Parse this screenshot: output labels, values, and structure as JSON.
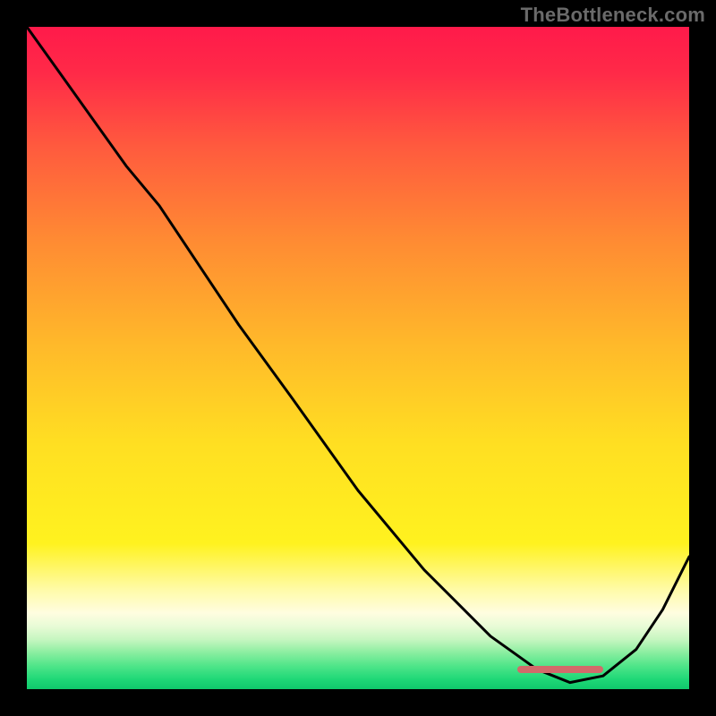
{
  "attribution": "TheBottleneck.com",
  "gradient_stops": [
    {
      "offset": 0.0,
      "color": "#ff1a4a"
    },
    {
      "offset": 0.07,
      "color": "#ff2a48"
    },
    {
      "offset": 0.18,
      "color": "#ff5a3e"
    },
    {
      "offset": 0.32,
      "color": "#ff8a33"
    },
    {
      "offset": 0.48,
      "color": "#ffb92a"
    },
    {
      "offset": 0.63,
      "color": "#ffdf22"
    },
    {
      "offset": 0.78,
      "color": "#fff21f"
    },
    {
      "offset": 0.85,
      "color": "#fffba8"
    },
    {
      "offset": 0.885,
      "color": "#fffde0"
    },
    {
      "offset": 0.905,
      "color": "#e8fbd6"
    },
    {
      "offset": 0.925,
      "color": "#c6f6c0"
    },
    {
      "offset": 0.945,
      "color": "#8aeea0"
    },
    {
      "offset": 0.965,
      "color": "#4fe589"
    },
    {
      "offset": 0.985,
      "color": "#1fd877"
    },
    {
      "offset": 1.0,
      "color": "#10c96b"
    }
  ],
  "marker": {
    "x_start": 0.74,
    "x_end": 0.87,
    "y": 0.97,
    "color": "#d26a6a"
  },
  "chart_data": {
    "type": "line",
    "title": "",
    "xlabel": "",
    "ylabel": "",
    "xlim": [
      0,
      1
    ],
    "ylim": [
      0,
      1
    ],
    "x": [
      0.0,
      0.05,
      0.1,
      0.15,
      0.2,
      0.26,
      0.32,
      0.4,
      0.5,
      0.6,
      0.7,
      0.77,
      0.82,
      0.87,
      0.92,
      0.96,
      1.0
    ],
    "values": [
      1.0,
      0.93,
      0.86,
      0.79,
      0.73,
      0.64,
      0.55,
      0.44,
      0.3,
      0.18,
      0.08,
      0.03,
      0.01,
      0.02,
      0.06,
      0.12,
      0.2
    ],
    "optimal_range": {
      "x_start": 0.74,
      "x_end": 0.87
    }
  }
}
